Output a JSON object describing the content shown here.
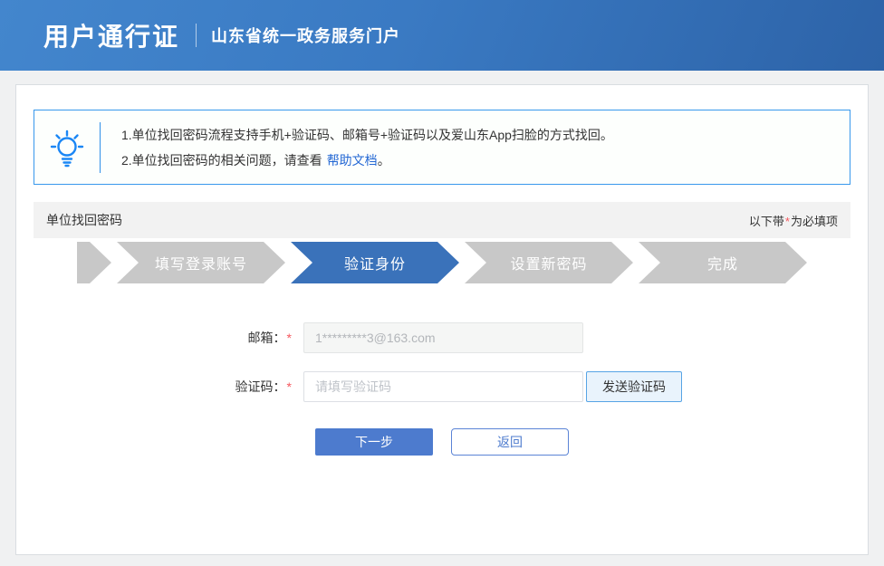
{
  "header": {
    "title": "用户通行证",
    "subtitle": "山东省统一政务服务门户"
  },
  "tip": {
    "line1": "1.单位找回密码流程支持手机+验证码、邮箱号+验证码以及爱山东App扫脸的方式找回。",
    "line2_prefix": "2.单位找回密码的相关问题，请查看",
    "line2_link": "帮助文档",
    "line2_suffix": "。"
  },
  "section": {
    "title": "单位找回密码",
    "required_prefix": "以下带",
    "required_star": "*",
    "required_suffix": "为必填项"
  },
  "steps": [
    {
      "label": "填写登录账号",
      "active": false
    },
    {
      "label": "验证身份",
      "active": true
    },
    {
      "label": "设置新密码",
      "active": false
    },
    {
      "label": "完成",
      "active": false
    }
  ],
  "form": {
    "email_label": "邮箱：",
    "email_required": "*",
    "email_value": "1*********3@163.com",
    "code_label": "验证码：",
    "code_required": "*",
    "code_placeholder": "请填写验证码",
    "send_code_button": "发送验证码",
    "next_button": "下一步",
    "back_button": "返回"
  },
  "colors": {
    "header_blue_light": "#4386cd",
    "header_blue_dark": "#2d63a8",
    "active_step": "#3a72ba",
    "inactive_step": "#c8c8c8",
    "primary_button": "#4d7bce",
    "tip_border": "#3898ec",
    "link": "#2468d4",
    "required_red": "#f5575e",
    "icon_blue": "#1b87f5"
  }
}
